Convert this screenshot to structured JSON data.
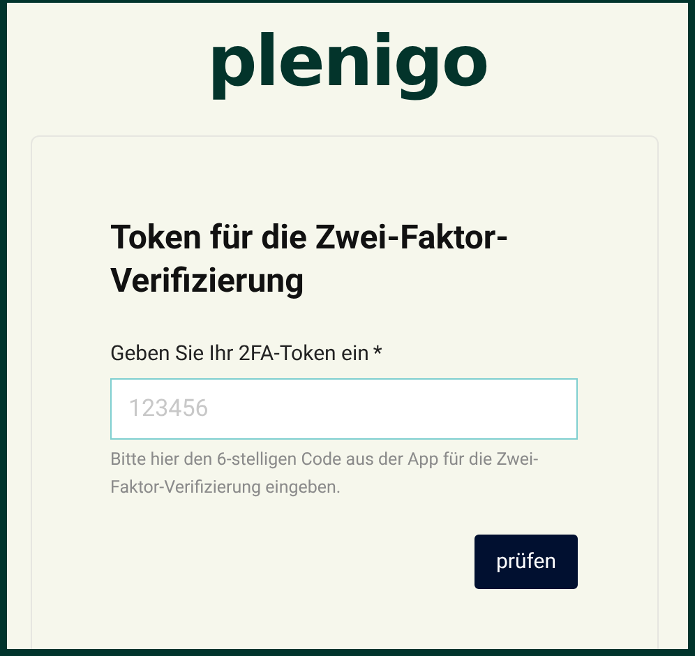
{
  "logo": "plenigo",
  "title": "Token für die Zwei-Faktor-Verifizierung",
  "field": {
    "label": "Geben Sie Ihr 2FA-Token ein",
    "required_mark": "*",
    "placeholder": "123456",
    "help": "Bitte hier den 6-stelligen Code aus der App für die Zwei-Faktor-Verifizierung eingeben."
  },
  "button": "prüfen"
}
